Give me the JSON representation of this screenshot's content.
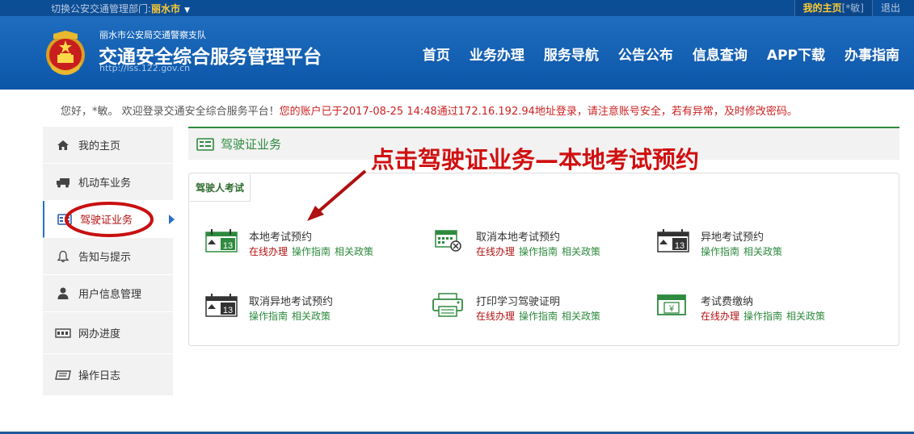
{
  "topbar": {
    "dept_label": "切换公安交通管理部门:",
    "dept_city": "丽水市",
    "my_home": "我的主页",
    "user": "[*敏]",
    "logout": "退出"
  },
  "header": {
    "org": "丽水市公安局交通警察支队",
    "title": "交通安全综合服务管理平台",
    "url": "http://lss.122.gov.cn",
    "nav": [
      "首页",
      "业务办理",
      "服务导航",
      "公告公布",
      "信息查询",
      "APP下载",
      "办事指南"
    ]
  },
  "welcome": {
    "greeting": "您好，*敏。 欢迎登录交通安全综合服务平台！",
    "warning": "您的账户已于2017-08-25 14:48通过172.16.192.94地址登录，请注意账号安全，若有异常，及时修改密码。"
  },
  "sidebar": {
    "items": [
      {
        "label": "我的主页",
        "icon": "home-icon"
      },
      {
        "label": "机动车业务",
        "icon": "truck-icon"
      },
      {
        "label": "驾驶证业务",
        "icon": "license-icon"
      },
      {
        "label": "告知与提示",
        "icon": "bell-icon"
      },
      {
        "label": "用户信息管理",
        "icon": "user-icon"
      },
      {
        "label": "网办进度",
        "icon": "progress-icon"
      },
      {
        "label": "操作日志",
        "icon": "log-icon"
      }
    ]
  },
  "main": {
    "section_title": "驾驶证业务",
    "tab": "驾驶人考试",
    "services": [
      {
        "name": "本地考试预约",
        "icon": "calendar-13-icon",
        "links": [
          "在线办理",
          "操作指南",
          "相关政策"
        ]
      },
      {
        "name": "取消本地考试预约",
        "icon": "calendar-cancel-icon",
        "links": [
          "在线办理",
          "操作指南",
          "相关政策"
        ]
      },
      {
        "name": "异地考试预约",
        "icon": "calendar-13-icon",
        "links": [
          "操作指南",
          "相关政策"
        ]
      },
      {
        "name": "取消异地考试预约",
        "icon": "calendar-13-icon",
        "links": [
          "操作指南",
          "相关政策"
        ]
      },
      {
        "name": "打印学习驾驶证明",
        "icon": "printer-icon",
        "links": [
          "在线办理",
          "操作指南",
          "相关政策"
        ]
      },
      {
        "name": "考试费缴纳",
        "icon": "yuan-bill-icon",
        "links": [
          "在线办理",
          "操作指南",
          "相关政策"
        ]
      }
    ],
    "calendar_day": "13"
  },
  "annotation": {
    "text": "点击驾驶证业务—本地考试预约",
    "color": "#d01010"
  }
}
